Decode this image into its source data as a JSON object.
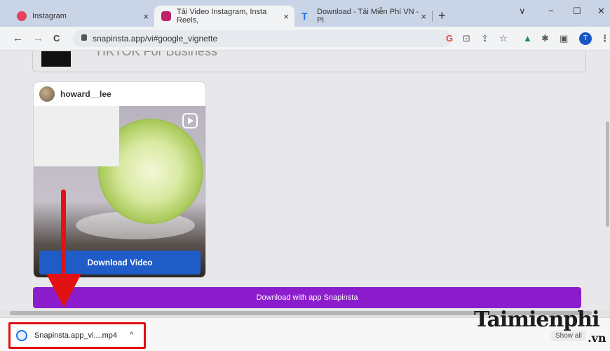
{
  "tabs": [
    {
      "title": "Instagram",
      "close": "×",
      "color": "#e4405f"
    },
    {
      "title": "Tải Video Instagram, Insta Reels,",
      "close": "×",
      "color": "#c0226a"
    },
    {
      "title": "Download - Tải Miễn Phí VN - Pl",
      "close": "×",
      "color": "#1a73e8"
    }
  ],
  "window": {
    "new_tab": "+",
    "dropdown": "∨",
    "minimize": "−",
    "maximize": "☐",
    "close": "✕"
  },
  "toolbar": {
    "back": "←",
    "forward": "→",
    "reload": "C",
    "url": "snapinsta.app/vi#google_vignette",
    "icons": {
      "google": "G",
      "install": "⊡",
      "share": "⇪",
      "star": "☆",
      "drive": "▲",
      "extensions": "✱",
      "sidepanel": "▣",
      "menu": "⋮"
    },
    "profile_initial": "T"
  },
  "page": {
    "prev_card_text": "TIKTOK For Business",
    "post": {
      "username": "howard__lee",
      "download_video_label": "Download Video"
    },
    "download_app_label": "Download with app Snapinsta"
  },
  "shelf": {
    "file_name": "Snapinsta.app_vi....mp4",
    "caret": "^",
    "show_all": "Show all"
  },
  "watermark": {
    "main": "Taimienphi",
    "sub": ".vn"
  },
  "colors": {
    "download_button": "#1f5cc8",
    "app_button": "#8b1dcc",
    "highlight": "#e01010"
  }
}
